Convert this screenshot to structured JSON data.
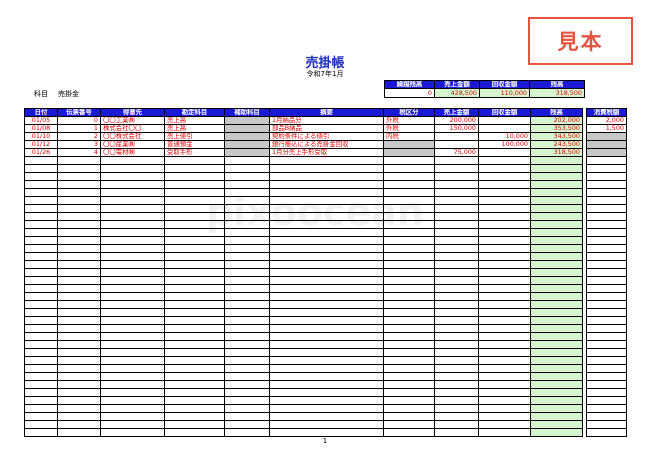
{
  "stamp": "見本",
  "title": "売掛帳",
  "subtitle": "令和7年1月",
  "subject_label": "科目",
  "subject_value": "売掛金",
  "summary": {
    "headers": [
      "繰越残高",
      "売上金額",
      "回収金額",
      "残高"
    ],
    "values": [
      "0",
      "428,500",
      "110,000",
      "318,500"
    ]
  },
  "ledger": {
    "headers": [
      "日付",
      "伝票番号",
      "得意先",
      "勘定科目",
      "補助科目",
      "摘要",
      "税区分",
      "売上金額",
      "回収金額",
      "残高"
    ],
    "rows": [
      {
        "date": "01/05",
        "no": "0",
        "customer": "〇〇工業㈱",
        "account": "売上高",
        "sub": "",
        "desc": "1月納品分",
        "tax": "外税",
        "sales": "200,000",
        "collect": "",
        "balance": "202,000"
      },
      {
        "date": "01/08",
        "no": "1",
        "customer": "株式会社〇〇",
        "account": "売上高",
        "sub": "",
        "desc": "部品B納品",
        "tax": "外税",
        "sales": "150,000",
        "collect": "",
        "balance": "353,500"
      },
      {
        "date": "01/10",
        "no": "2",
        "customer": "〇〇株式会社",
        "account": "売上値引",
        "sub": "",
        "desc": "契約条件による値引",
        "tax": "内税",
        "sales": "",
        "collect": "10,000",
        "balance": "343,500"
      },
      {
        "date": "01/12",
        "no": "3",
        "customer": "〇〇産業㈱",
        "account": "普通預金",
        "sub": "",
        "desc": "銀行振込による売掛金回収",
        "tax": "",
        "sales": "",
        "collect": "100,000",
        "balance": "243,500"
      },
      {
        "date": "01/26",
        "no": "4",
        "customer": "〇〇電材㈱",
        "account": "受取手形",
        "sub": "",
        "desc": "1月分売上手形受取",
        "tax": "",
        "sales": "75,000",
        "collect": "",
        "balance": "318,500"
      }
    ],
    "empty_rows": 35
  },
  "tax_table": {
    "header": "消費税額",
    "values": [
      "2,000",
      "1,500"
    ],
    "empty_rows": 38
  },
  "footer": "1",
  "watermark": "pixoocean"
}
